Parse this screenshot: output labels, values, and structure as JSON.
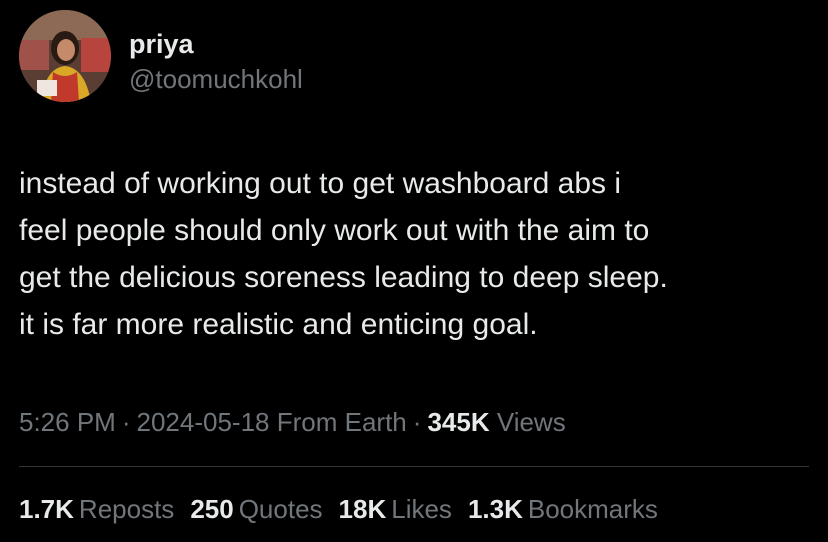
{
  "author": {
    "display_name": "priya",
    "handle": "@toomuchkohl"
  },
  "tweet": {
    "lines": [
      "instead of working out to get washboard abs i",
      "feel people should only work out with the aim to",
      "get the delicious soreness leading to deep sleep.",
      "it is far more realistic and enticing goal."
    ]
  },
  "meta": {
    "time": "5:26 PM",
    "separator": "·",
    "date": "2024-05-18",
    "location": "From Earth",
    "views_count": "345K",
    "views_label": "Views"
  },
  "stats": {
    "reposts": {
      "count": "1.7K",
      "label": "Reposts"
    },
    "quotes": {
      "count": "250",
      "label": "Quotes"
    },
    "likes": {
      "count": "18K",
      "label": "Likes"
    },
    "bookmarks": {
      "count": "1.3K",
      "label": "Bookmarks"
    }
  },
  "colors": {
    "background": "#000000",
    "primary_text": "#e7e9ea",
    "secondary_text": "#71767b",
    "divider": "#2f3336"
  }
}
